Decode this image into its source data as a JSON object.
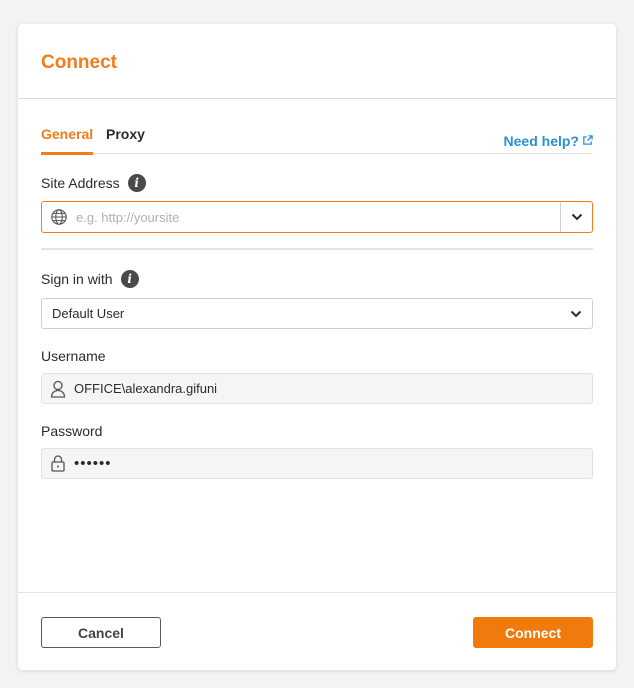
{
  "dialog": {
    "title": "Connect",
    "tabs": [
      {
        "label": "General",
        "active": true
      },
      {
        "label": "Proxy",
        "active": false
      }
    ],
    "help_link": "Need help?",
    "site_address": {
      "label": "Site Address",
      "placeholder": "e.g. http://yoursite",
      "value": ""
    },
    "sign_in": {
      "label": "Sign in with",
      "selected": "Default User"
    },
    "username": {
      "label": "Username",
      "value": "OFFICE\\alexandra.gifuni"
    },
    "password": {
      "label": "Password",
      "masked_value": "••••••"
    },
    "buttons": {
      "cancel": "Cancel",
      "connect": "Connect"
    }
  },
  "colors": {
    "accent": "#f07c1a",
    "link": "#2a8fd6",
    "primary_button": "#f07a0c"
  },
  "icons": {
    "info": "info-icon",
    "globe": "globe-icon",
    "chevron": "chevron-down-icon",
    "user": "user-icon",
    "lock": "lock-icon",
    "external": "external-link-icon"
  }
}
